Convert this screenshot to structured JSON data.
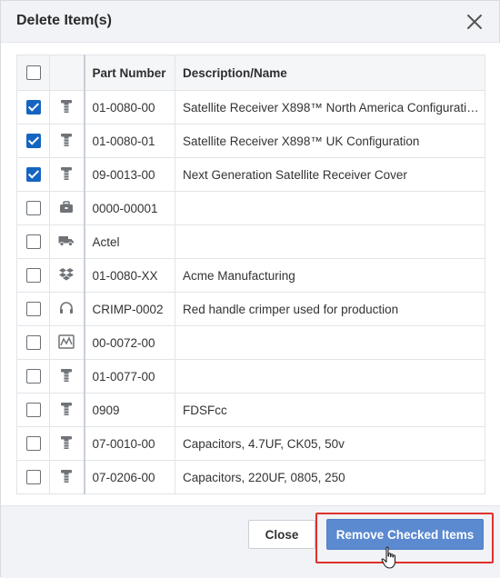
{
  "dialog": {
    "title": "Delete Item(s)"
  },
  "table": {
    "columns": [
      "Part Number",
      "Description/Name"
    ],
    "rows": [
      {
        "checked": true,
        "icon": "part-icon",
        "part_number": "01-0080-00",
        "description": "Satellite Receiver X898™ North America Configurati…"
      },
      {
        "checked": true,
        "icon": "part-icon",
        "part_number": "01-0080-01",
        "description": "Satellite Receiver X898™ UK Configuration"
      },
      {
        "checked": true,
        "icon": "part-icon",
        "part_number": "09-0013-00",
        "description": "Next Generation Satellite Receiver Cover"
      },
      {
        "checked": false,
        "icon": "toolbox-icon",
        "part_number": "0000-00001",
        "description": ""
      },
      {
        "checked": false,
        "icon": "truck-icon",
        "part_number": "Actel",
        "description": ""
      },
      {
        "checked": false,
        "icon": "dropbox-icon",
        "part_number": "01-0080-XX",
        "description": "Acme Manufacturing"
      },
      {
        "checked": false,
        "icon": "headset-icon",
        "part_number": "CRIMP-0002",
        "description": "Red handle crimper used for production"
      },
      {
        "checked": false,
        "icon": "chart-image-icon",
        "part_number": "00-0072-00",
        "description": ""
      },
      {
        "checked": false,
        "icon": "part-icon",
        "part_number": "01-0077-00",
        "description": ""
      },
      {
        "checked": false,
        "icon": "part-icon",
        "part_number": "0909",
        "description": "FDSFcc"
      },
      {
        "checked": false,
        "icon": "part-icon",
        "part_number": "07-0010-00",
        "description": "Capacitors, 4.7UF, CK05, 50v"
      },
      {
        "checked": false,
        "icon": "part-icon",
        "part_number": "07-0206-00",
        "description": "Capacitors, 220UF, 0805, 250"
      }
    ]
  },
  "footer": {
    "close_label": "Close",
    "remove_label": "Remove Checked Items"
  },
  "colors": {
    "checkbox_checked": "#1565c0",
    "primary_button": "#5b8ad0",
    "highlight_border": "#e0312b"
  }
}
